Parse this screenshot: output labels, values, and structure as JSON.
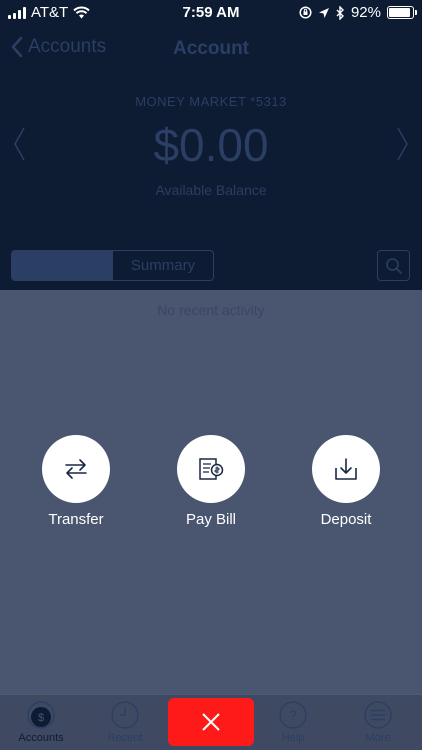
{
  "status_bar": {
    "carrier": "AT&T",
    "time": "7:59 AM",
    "battery": "92%",
    "battery_level": 0.92,
    "icons": [
      "signal-icon",
      "wifi-icon",
      "rotation-lock-icon",
      "location-icon",
      "bluetooth-icon",
      "battery-icon"
    ]
  },
  "nav": {
    "back_label": "Accounts",
    "title": "Account"
  },
  "account": {
    "name": "MONEY MARKET *5313",
    "balance": "$0.00",
    "balance_label": "Available Balance"
  },
  "segments": {
    "active": "",
    "summary": "Summary"
  },
  "activity": {
    "empty_message": "No recent activity"
  },
  "actions": [
    {
      "label": "Transfer",
      "icon": "transfer-icon"
    },
    {
      "label": "Pay Bill",
      "icon": "pay-bill-icon"
    },
    {
      "label": "Deposit",
      "icon": "deposit-icon"
    }
  ],
  "tabbar": {
    "items": [
      {
        "label": "Accounts",
        "icon": "dollar-icon"
      },
      {
        "label": "Recent",
        "icon": "clock-icon"
      },
      {
        "label": "Help",
        "icon": "help-icon"
      },
      {
        "label": "More",
        "icon": "menu-icon"
      }
    ],
    "close_icon": "close-icon",
    "close_color": "#ff1a1a"
  },
  "colors": {
    "header_bg": "#0d1b33",
    "overlay_bg": "#4a5570",
    "action_circle": "#ffffff"
  }
}
